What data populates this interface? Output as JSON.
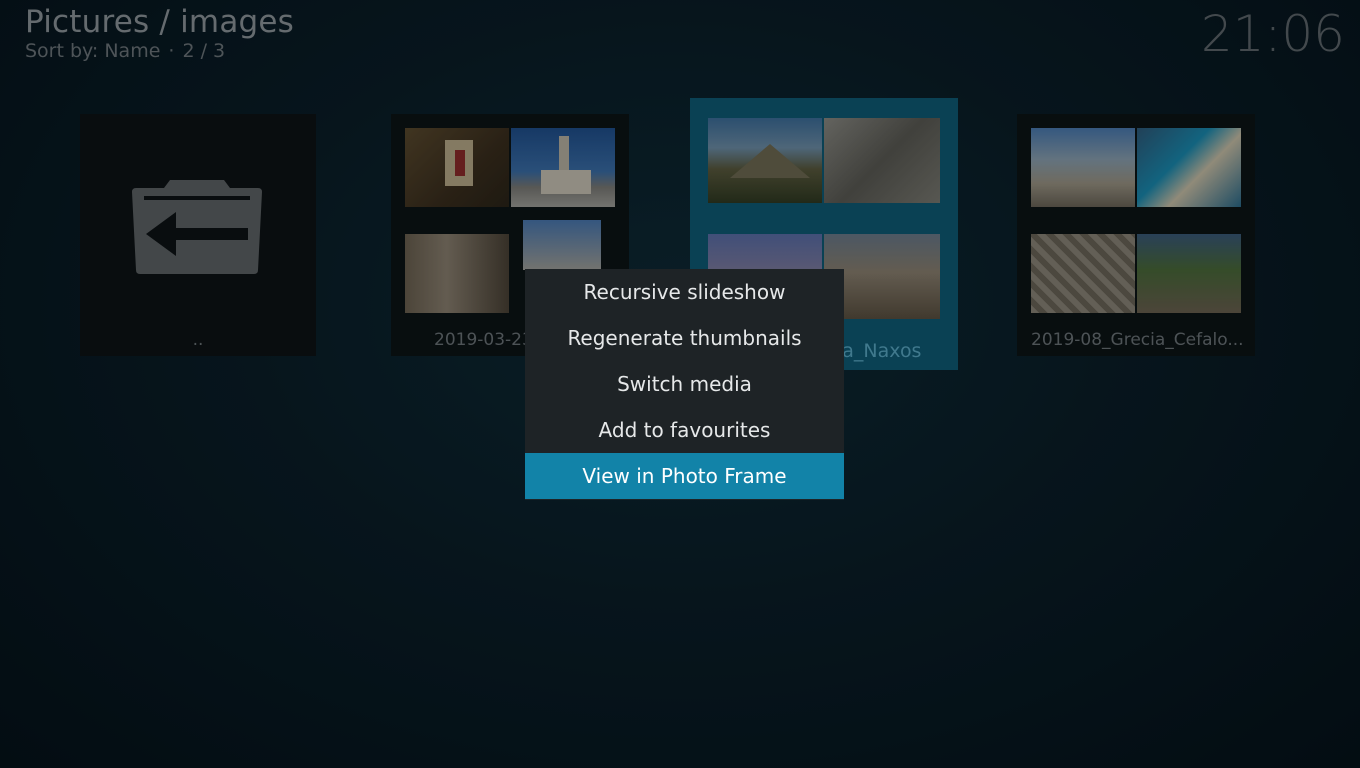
{
  "header": {
    "title": "Pictures / images",
    "sort_label": "Sort by: Name",
    "separator": "·",
    "page": "2 / 3"
  },
  "clock": "21:06",
  "tiles": [
    {
      "label": "..",
      "icon": "folder-back-icon"
    },
    {
      "label": "2019-03-23"
    },
    {
      "label": "ia_Naxos"
    },
    {
      "label": "2019-08_Grecia_Cefalo..."
    }
  ],
  "context_menu": {
    "items": [
      {
        "label": "Recursive slideshow"
      },
      {
        "label": "Regenerate thumbnails"
      },
      {
        "label": "Switch media"
      },
      {
        "label": "Add to favourites"
      },
      {
        "label": "View in Photo Frame"
      }
    ],
    "selected_index": 4
  },
  "colors": {
    "accent": "#1283a8",
    "focused_tile": "#0e5a75",
    "menu_bg": "#1e2326"
  }
}
